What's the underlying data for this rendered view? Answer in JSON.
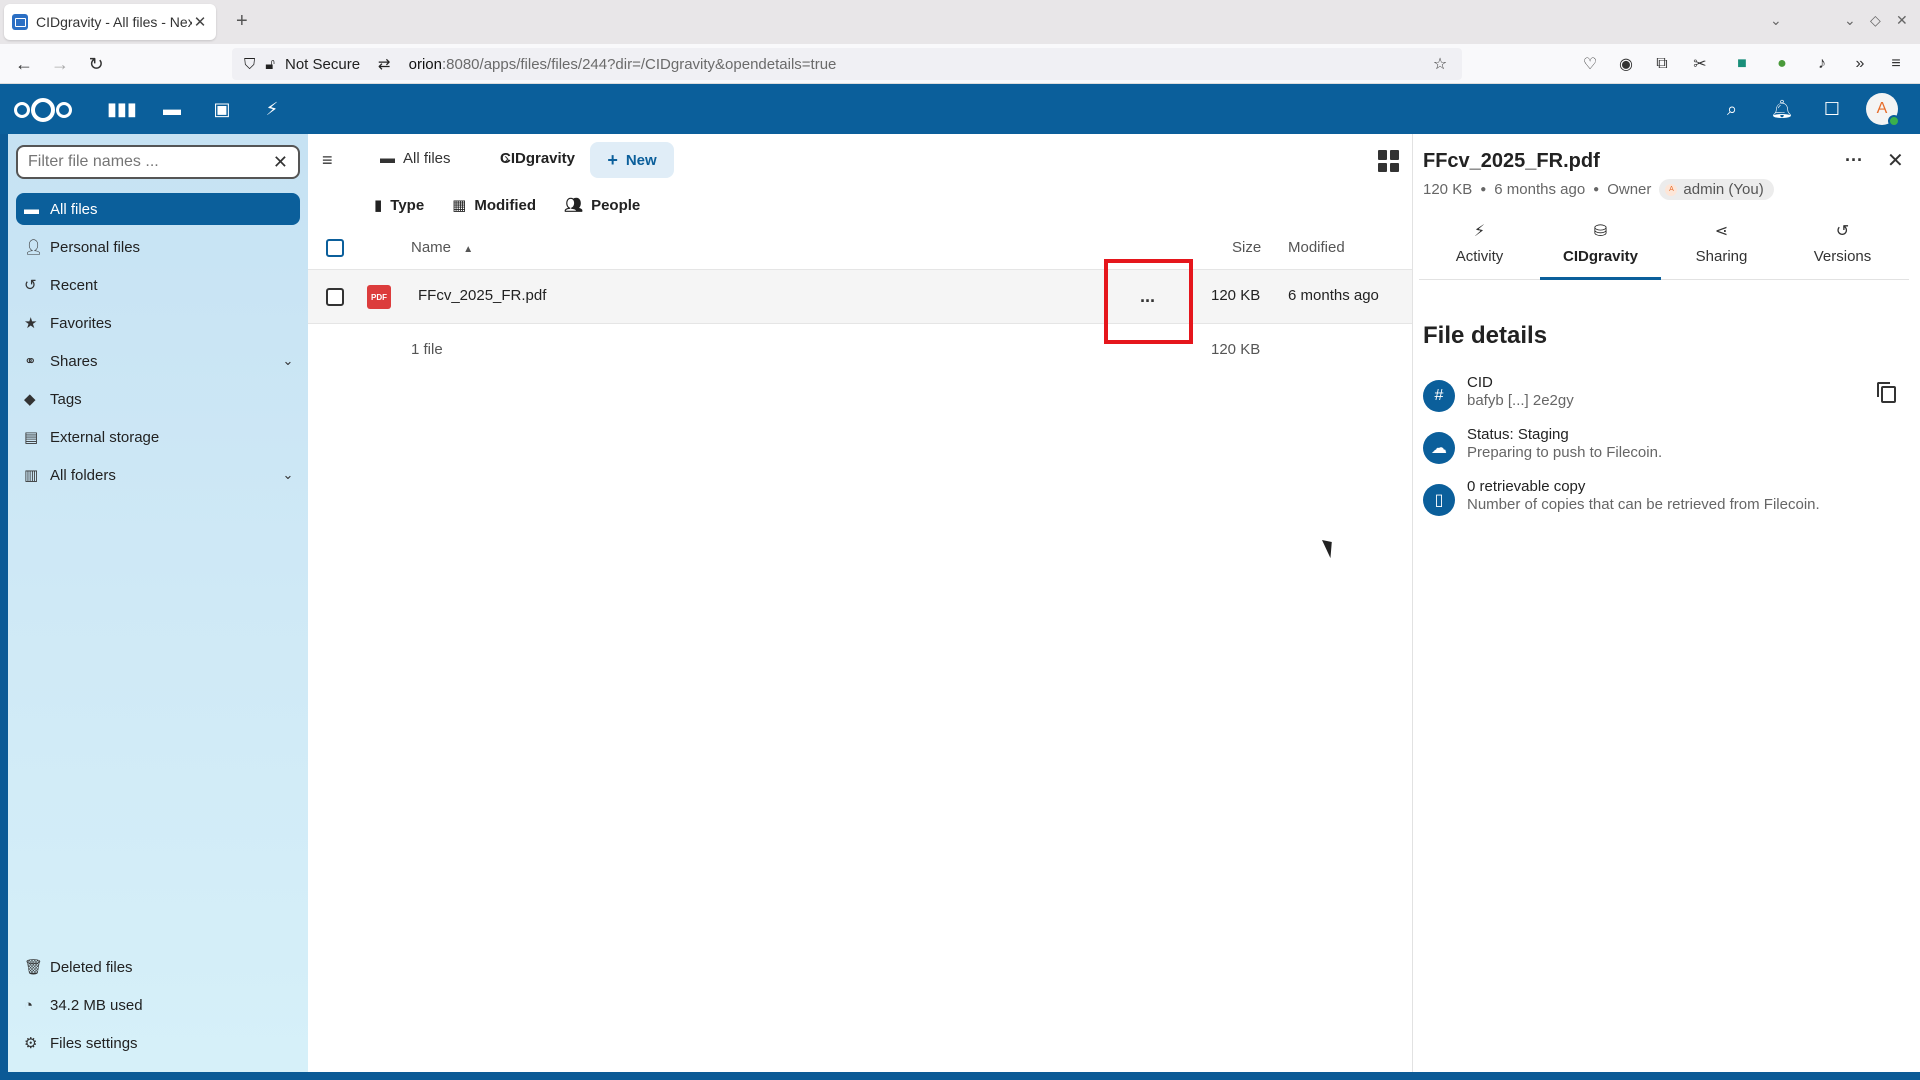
{
  "browser": {
    "tab_title": "CIDgravity - All files - Nextcloud",
    "security_label": "Not Secure",
    "url_host": "orion",
    "url_rest": ":8080/apps/files/files/244?dir=/CIDgravity&opendetails=true"
  },
  "header": {
    "apps": [
      "dashboard-icon",
      "files-icon",
      "photos-icon",
      "activity-icon"
    ],
    "avatar_initial": "A"
  },
  "sidebar_nav": {
    "filter_placeholder": "Filter file names ...",
    "items": [
      {
        "label": "All files",
        "icon": "folder-icon",
        "active": true
      },
      {
        "label": "Personal files",
        "icon": "person-icon"
      },
      {
        "label": "Recent",
        "icon": "history-icon"
      },
      {
        "label": "Favorites",
        "icon": "star-icon"
      },
      {
        "label": "Shares",
        "icon": "share-icon",
        "expandable": true
      },
      {
        "label": "Tags",
        "icon": "tag-icon"
      },
      {
        "label": "External storage",
        "icon": "storage-icon"
      },
      {
        "label": "All folders",
        "icon": "folders-icon",
        "expandable": true
      }
    ],
    "bottom": {
      "deleted": "Deleted files",
      "quota": "34.2 MB used",
      "settings": "Files settings"
    }
  },
  "main": {
    "breadcrumb_root": "All files",
    "breadcrumb_current": "CIDgravity",
    "new_label": "New",
    "filters": [
      "Type",
      "Modified",
      "People"
    ],
    "columns": {
      "name": "Name",
      "size": "Size",
      "modified": "Modified"
    },
    "files": [
      {
        "name": "FFcv_2025_FR.pdf",
        "size": "120 KB",
        "modified": "6 months ago",
        "type_badge": "PDF"
      }
    ],
    "summary_count": "1 file",
    "summary_size": "120 KB"
  },
  "details": {
    "file_name": "FFcv_2025_FR.pdf",
    "size": "120 KB",
    "modified": "6 months ago",
    "owner_label": "Owner",
    "owner_name": "admin (You)",
    "owner_initial": "A",
    "tabs": [
      {
        "label": "Activity",
        "icon": "activity-icon"
      },
      {
        "label": "CIDgravity",
        "icon": "cidgravity-icon",
        "active": true
      },
      {
        "label": "Sharing",
        "icon": "share-icon"
      },
      {
        "label": "Versions",
        "icon": "history-icon"
      }
    ],
    "section_title": "File details",
    "rows": [
      {
        "title": "CID",
        "sub": "bafyb [...] 2e2gy",
        "icon": "hash-icon"
      },
      {
        "title": "Status: Staging",
        "sub": "Preparing to push to Filecoin.",
        "icon": "cloud-upload-icon"
      },
      {
        "title": "0 retrievable copy",
        "sub": "Number of copies that can be retrieved from Filecoin.",
        "icon": "file-icon"
      }
    ]
  },
  "colors": {
    "brand": "#0b5f9b",
    "highlight": "#e5161c",
    "pdf": "#dc3c3c"
  }
}
